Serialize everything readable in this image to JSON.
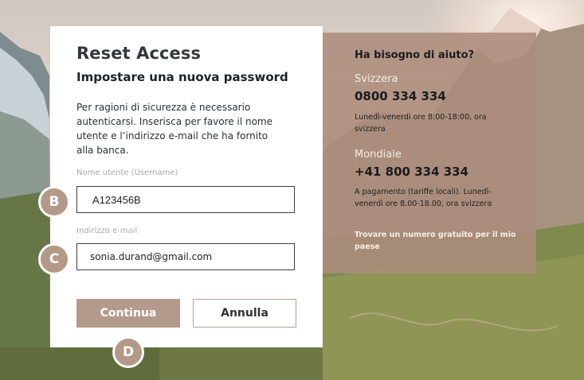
{
  "form": {
    "title": "Reset Access",
    "subtitle": "Impostare una nuova password",
    "description": "Per ragioni di sicurezza è necessario autenticarsi. Inserisca per favore il nome utente e l’indirizzo e-mail che ha fornito alla banca.",
    "username_label": "Nome utente (Username)",
    "username_value": "A123456B",
    "email_label": "Indirizzo e-mail",
    "email_value": "sonia.durand@gmail.com",
    "continue_label": "Continua",
    "cancel_label": "Annulla"
  },
  "markers": {
    "b": "B",
    "c": "C",
    "d": "D"
  },
  "help": {
    "title": "Ha bisogno di aiuto?",
    "switzerland_label": "Svizzera",
    "switzerland_phone": "0800 334 334",
    "switzerland_hours": "Lunedì-venerdì ore 8:00-18:00, ora svizzera",
    "world_label": "Mondiale",
    "world_phone": "+41 800 334 334",
    "world_info": "A pagamento (tariffe locali). Lunedì-venerdì ore 8.00-18.00, ora svizzera",
    "free_number_link": "Trovare un numero gratuito per il mio paese"
  },
  "colors": {
    "accent": "#b39a8a",
    "help_panel": "#ac8c7c"
  }
}
